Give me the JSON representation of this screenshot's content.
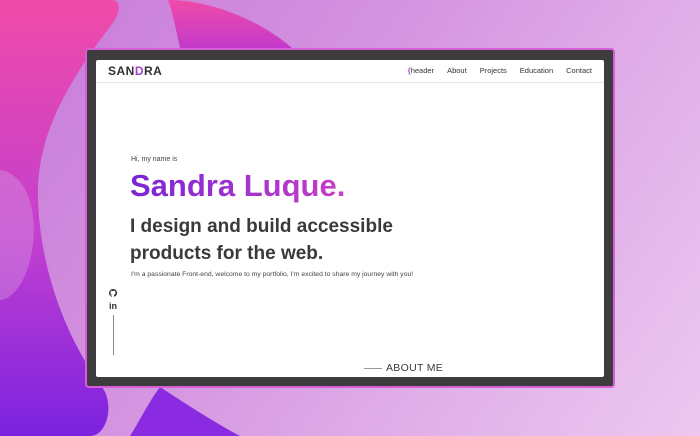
{
  "colors": {
    "accent": "#a43ec9",
    "gradient_start": "#7a24d6",
    "gradient_end": "#c83fc6",
    "frame_border": "#d65fd6"
  },
  "logo": {
    "part1": "SAN",
    "part2": "D",
    "part3": "RA"
  },
  "nav": {
    "brace": "{",
    "items": [
      "header",
      "About",
      "Projects",
      "Education",
      "Contact"
    ]
  },
  "hero": {
    "greeting": "Hi, my name is",
    "name": "Sandra Luque.",
    "tagline": "I design and build accessible products for the web.",
    "intro": "I'm a passionate Front-end, welcome to my portfolio, I'm excited to share my journey with you!"
  },
  "social": {
    "github_icon": "github-icon",
    "linkedin_icon": "linkedin-icon",
    "linkedin_text": "in"
  },
  "about": {
    "label": "ABOUT ME"
  }
}
